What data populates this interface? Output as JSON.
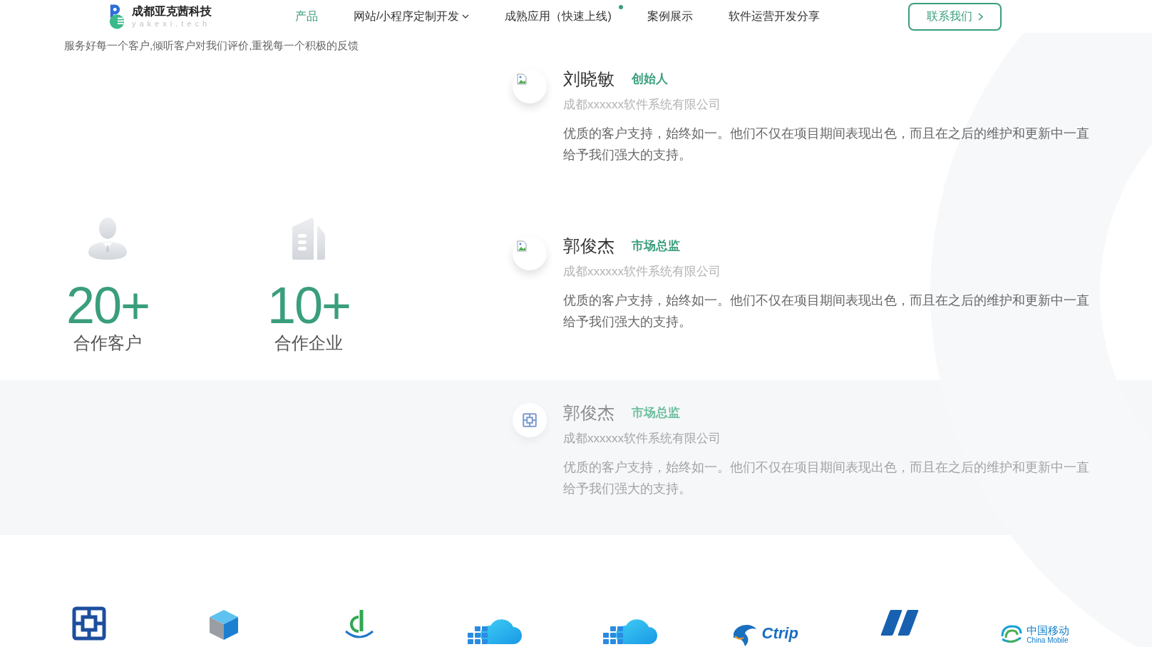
{
  "header": {
    "brand": {
      "name": "成都亚克茜科技",
      "domain": "yakexi.tech"
    },
    "nav": [
      {
        "label": "产品",
        "selected": true,
        "dropdown": false,
        "dot": false
      },
      {
        "label": "网站/小程序定制开发",
        "selected": false,
        "dropdown": true,
        "dot": false
      },
      {
        "label": "成熟应用（快速上线)",
        "selected": false,
        "dropdown": false,
        "dot": true
      },
      {
        "label": "案例展示",
        "selected": false,
        "dropdown": false,
        "dot": false
      },
      {
        "label": "软件运营开发分享",
        "selected": false,
        "dropdown": false,
        "dot": false
      }
    ],
    "contact_button": "联系我们"
  },
  "intro": "服务好每一个客户,倾听客户对我们评价,重视每一个积极的反馈",
  "stats": [
    {
      "kind": "person",
      "value": "20+",
      "label": "合作客户"
    },
    {
      "kind": "building",
      "value": "10+",
      "label": "合作企业"
    }
  ],
  "testimonials": [
    {
      "kind": "placeholder",
      "name": "刘晓敏",
      "role": "创始人",
      "company": "成都xxxxxx软件系统有限公司",
      "quote": "优质的客户支持，始终如一。他们不仅在项目期间表现出色，而且在之后的维护和更新中一直给予我们强大的支持。",
      "faded": false
    },
    {
      "kind": "placeholder",
      "name": "郭俊杰",
      "role": "市场总监",
      "company": "成都xxxxxx软件系统有限公司",
      "quote": "优质的客户支持，始终如一。他们不仅在项目期间表现出色，而且在之后的维护和更新中一直给予我们强大的支持。",
      "faded": false
    },
    {
      "kind": "logo",
      "name": "郭俊杰",
      "role": "市场总监",
      "company": "成都xxxxxx软件系统有限公司",
      "quote": "优质的客户支持，始终如一。他们不仅在项目期间表现出色，而且在之后的维护和更新中一直给予我们强大的支持。",
      "faded": true
    }
  ],
  "partners": [
    {
      "kind": "knot"
    },
    {
      "kind": "cube"
    },
    {
      "kind": "leaf"
    },
    {
      "kind": "cloud"
    },
    {
      "kind": "cloud"
    },
    {
      "kind": "dolphin",
      "wordmark": [
        "Ctrip"
      ]
    },
    {
      "kind": "swoosh"
    },
    {
      "kind": "swirl",
      "wordmark": [
        "中国移动",
        "China Mobile"
      ]
    }
  ]
}
